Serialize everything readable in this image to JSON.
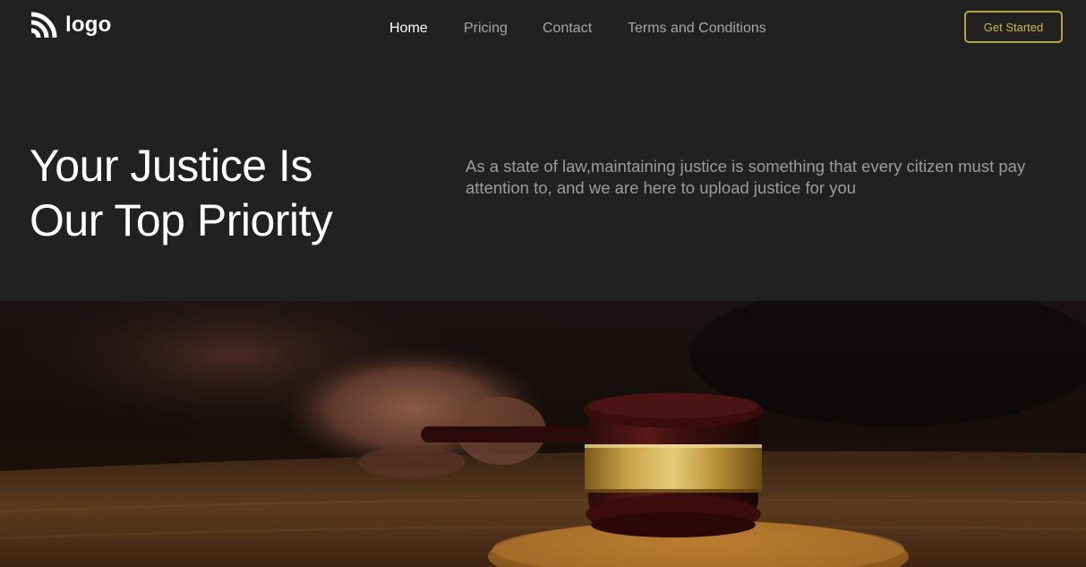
{
  "brand": {
    "logo_text": "logo",
    "logo_icon": "wifi-arcs-icon"
  },
  "nav": {
    "items": [
      {
        "label": "Home",
        "active": true
      },
      {
        "label": "Pricing",
        "active": false
      },
      {
        "label": "Contact",
        "active": false
      },
      {
        "label": "Terms and Conditions",
        "active": false
      }
    ]
  },
  "cta": {
    "label": "Get Started"
  },
  "hero": {
    "title_line1": "Your Justice Is",
    "title_line2": "Our Top Priority",
    "description": "As a state of law,maintaining justice is something that every citizen must pay attention to, and we are here to upload justice for you"
  },
  "colors": {
    "background": "#222122",
    "accent": "#b5a73e",
    "text_primary": "#ffffff",
    "text_muted": "#a6a6a6"
  }
}
